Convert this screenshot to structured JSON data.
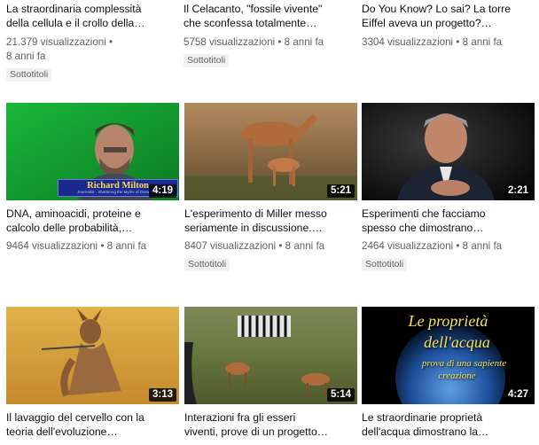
{
  "top_row": [
    {
      "title": "La straordinaria complessità\ndella cellula e il crollo della…",
      "views": "21.379 visualizzazioni •",
      "age": "8 anni fa",
      "badge": "Sottotitoli"
    },
    {
      "title": "Il Celacanto, \"fossile vivente\"\nche sconfessa totalmente…",
      "views": "5758 visualizzazioni",
      "age": "8 anni fa",
      "badge": "Sottotitoli"
    },
    {
      "title": "Do You Know? Lo sai? La torre\nEiffel aveva un progetto?…",
      "views": "3304 visualizzazioni",
      "age": "8 anni fa"
    }
  ],
  "middle_row": [
    {
      "title": "DNA, aminoacidi, proteine e\ncalcolo delle probabilità,…",
      "views": "9464 visualizzazioni",
      "age": "8 anni fa",
      "duration": "4:19",
      "thumb_caption_name": "Richard Milton",
      "thumb_caption_sub": "Journalist · Shattering the Myths of Darwinism"
    },
    {
      "title": "L'esperimento di Miller messo\nseriamente in discussione.…",
      "views": "8407 visualizzazioni",
      "age": "8 anni fa",
      "duration": "5:21",
      "badge": "Sottotitoli"
    },
    {
      "title": "Esperimenti che facciamo\nspesso che dimostrano…",
      "views": "2464 visualizzazioni",
      "age": "8 anni fa",
      "duration": "2:21",
      "badge": "Sottotitoli"
    }
  ],
  "bottom_row": [
    {
      "title": "Il lavaggio del cervello con la\nteoria dell'evoluzione…",
      "duration": "3:13"
    },
    {
      "title": "Interazioni fra gli esseri\nviventi, prove di un progetto…",
      "duration": "5:14"
    },
    {
      "title": "Le straordinarie proprietà\ndell'acqua dimostrano la…",
      "duration": "4:27",
      "thumb_line1": "Le proprietà",
      "thumb_line2": "dell'acqua",
      "thumb_line3": "prova di una sapiente",
      "thumb_line4": "creazione"
    }
  ],
  "separator": "•",
  "colors": {
    "text": "#0f0f0f",
    "meta": "#606060",
    "badge_bg": "#f2f2f2"
  }
}
